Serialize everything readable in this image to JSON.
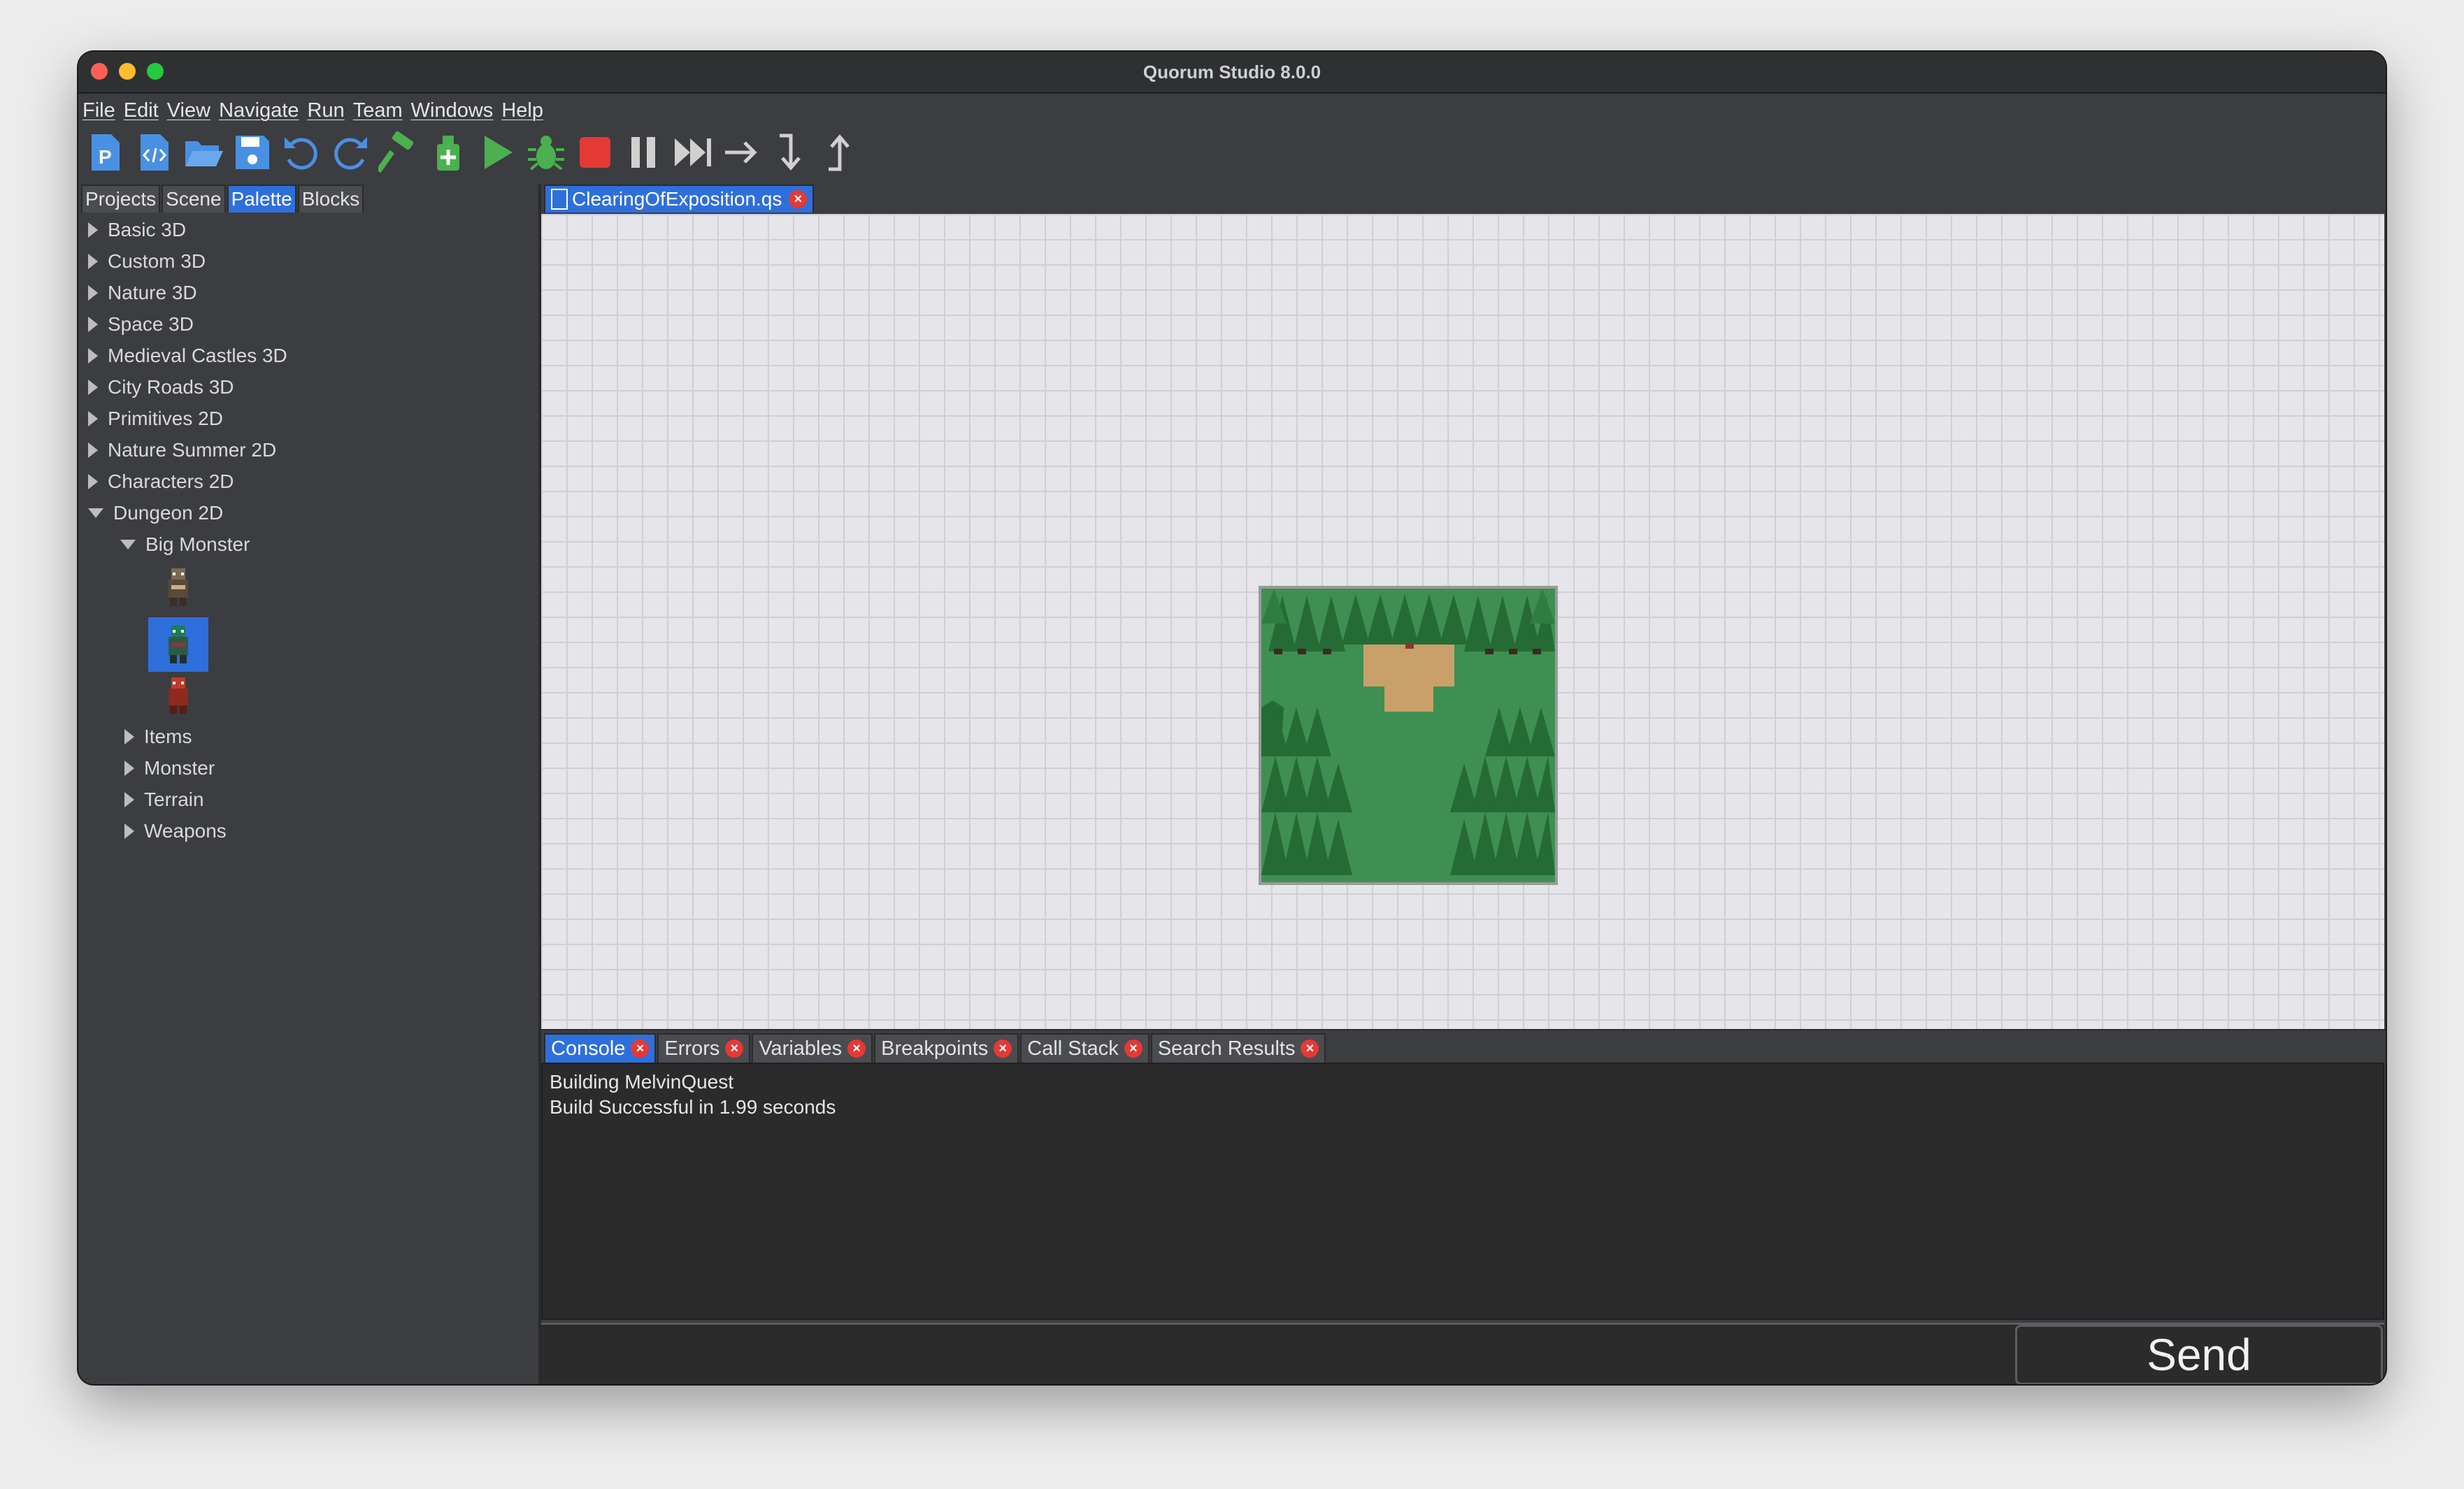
{
  "window": {
    "title": "Quorum Studio 8.0.0"
  },
  "menu": [
    "File",
    "Edit",
    "View",
    "Navigate",
    "Run",
    "Team",
    "Windows",
    "Help"
  ],
  "toolbar_icons": [
    "new-project-icon",
    "new-file-icon",
    "open-folder-icon",
    "save-icon",
    "undo-icon",
    "redo-icon",
    "build-hammer-icon",
    "clean-build-icon",
    "run-icon",
    "debug-bug-icon",
    "stop-icon",
    "pause-icon",
    "continue-icon",
    "step-over-icon",
    "step-into-icon",
    "step-out-icon"
  ],
  "left_tabs": [
    "Projects",
    "Scene",
    "Palette",
    "Blocks"
  ],
  "palette": {
    "categories": [
      "Basic 3D",
      "Custom 3D",
      "Nature 3D",
      "Space 3D",
      "Medieval Castles 3D",
      "City Roads 3D",
      "Primitives 2D",
      "Nature Summer 2D",
      "Characters 2D"
    ],
    "expanded": "Dungeon 2D",
    "subgroup": "Big Monster",
    "subitems": [
      "Items",
      "Monster",
      "Terrain",
      "Weapons"
    ]
  },
  "editor": {
    "tab": "ClearingOfExposition.qs"
  },
  "console_tabs": [
    "Console",
    "Errors",
    "Variables",
    "Breakpoints",
    "Call Stack",
    "Search Results"
  ],
  "console_lines": [
    "Building MelvinQuest",
    "Build Successful in 1.99 seconds"
  ],
  "send_label": "Send",
  "colors": {
    "accent": "#2f6fdc",
    "green": "#4caf50",
    "stop_red": "#e53935"
  }
}
